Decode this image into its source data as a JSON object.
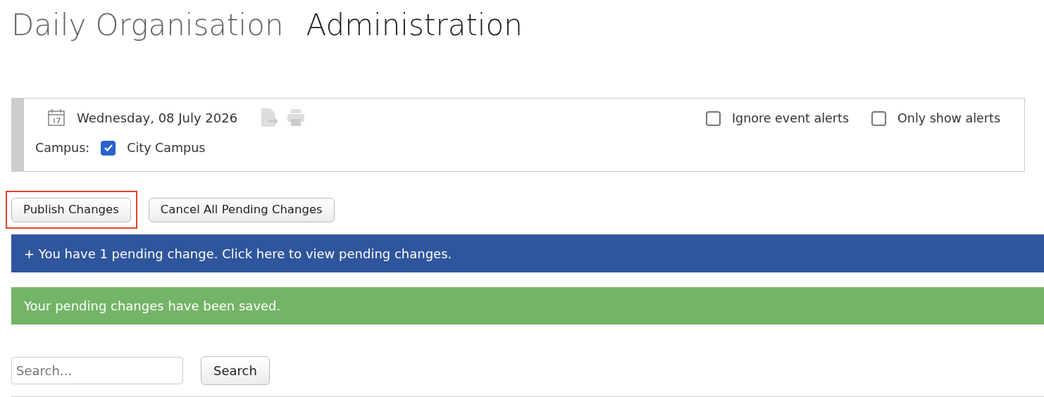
{
  "header": {
    "title": "Daily Organisation",
    "subtitle": "Administration"
  },
  "filter_panel": {
    "date": "Wednesday, 08 July 2026",
    "campus_label": "Campus:",
    "campuses": [
      {
        "label": "City Campus",
        "checked": true
      }
    ],
    "options": [
      {
        "label": "Ignore event alerts",
        "checked": false
      },
      {
        "label": "Only show alerts",
        "checked": false
      }
    ]
  },
  "buttons": [
    {
      "label": "Publish Changes",
      "highlighted": true
    },
    {
      "label": "Cancel All Pending Changes",
      "highlighted": false
    }
  ],
  "alerts": [
    {
      "kind": "info",
      "text": "+ You have 1 pending change. Click here to view pending changes."
    },
    {
      "kind": "success",
      "text": "Your pending changes have been saved."
    }
  ],
  "search": {
    "placeholder": "Search...",
    "button": "Search"
  }
}
